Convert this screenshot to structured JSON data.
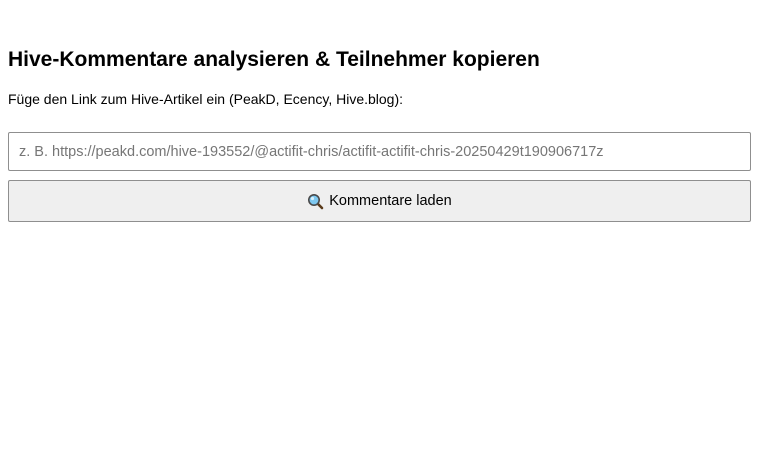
{
  "page": {
    "title": "Hive-Kommentare analysieren & Teilnehmer kopieren",
    "instruction": "Füge den Link zum Hive-Artikel ein (PeakD, Ecency, Hive.blog):"
  },
  "url_input": {
    "value": "",
    "placeholder": "z. B. https://peakd.com/hive-193552/@actifit-chris/actifit-actifit-chris-20250429t190906717z"
  },
  "load_button": {
    "label": "Kommentare laden",
    "icon": "magnifier-icon"
  },
  "colors": {
    "button_bg": "#efefef",
    "border": "#8f8f8f",
    "placeholder": "#767676",
    "icon_lens": "#7ec8f0"
  }
}
